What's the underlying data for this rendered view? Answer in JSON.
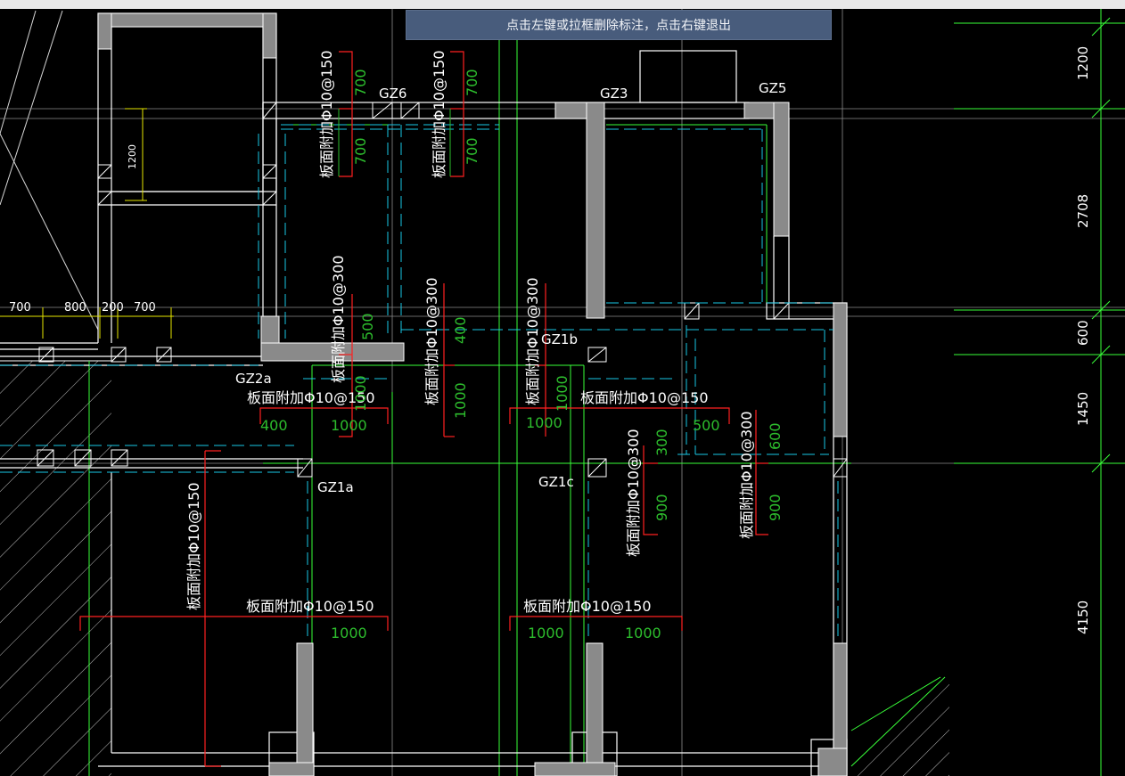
{
  "hint_bar": {
    "text": "点击左键或拉框删除标注，点击右键退出"
  },
  "colors": {
    "background": "#000000",
    "wall": "#8a8a8a",
    "wall_outline": "#ffffff",
    "grid_line": "#39ff39",
    "cyan_dash": "#19c8e6",
    "rebar_red": "#ff2020",
    "dim_green": "#2dbd2d",
    "dim_yellow": "#e6e600",
    "label_white": "#ffffff"
  },
  "column_labels": [
    "GZ6",
    "GZ3",
    "GZ5",
    "GZ1b",
    "GZ2a",
    "GZ1a",
    "GZ1c"
  ],
  "rebar_labels": {
    "v_150_a": "板面附加Φ10@150",
    "v_150_b": "板面附加Φ10@150",
    "v_300_a": "板面附加Φ10@300",
    "v_300_b": "板面附加Φ10@300",
    "v_300_c": "板面附加Φ10@300",
    "h_150_mid_a": "板面附加Φ10@150",
    "h_150_mid_b": "板面附加Φ10@150",
    "v_300_d": "板面附加Φ10@300",
    "v_300_e": "板面附加Φ10@300",
    "v_150_left": "板面附加Φ10@150",
    "h_150_low_a": "板面附加Φ10@150",
    "h_150_low_b": "板面附加Φ10@150"
  },
  "rebar_lengths": {
    "a1": "700",
    "a2": "700",
    "b1": "700",
    "b2": "700",
    "c1": "500",
    "d1": "400",
    "d2": "1000",
    "e1": "1000",
    "e2": "1000",
    "f1": "400",
    "f2": "1000",
    "g1": "1000",
    "g2": "500",
    "h1": "300",
    "h2": "900",
    "i1": "600",
    "i2": "900",
    "j1": "1000",
    "j2": "1000",
    "j3": "1000"
  },
  "dimensions_left": [
    "700",
    "800",
    "200",
    "700"
  ],
  "dimension_1200_inner": "1200",
  "dimensions_right": [
    "1200",
    "2708",
    "600",
    "1450",
    "4150"
  ]
}
